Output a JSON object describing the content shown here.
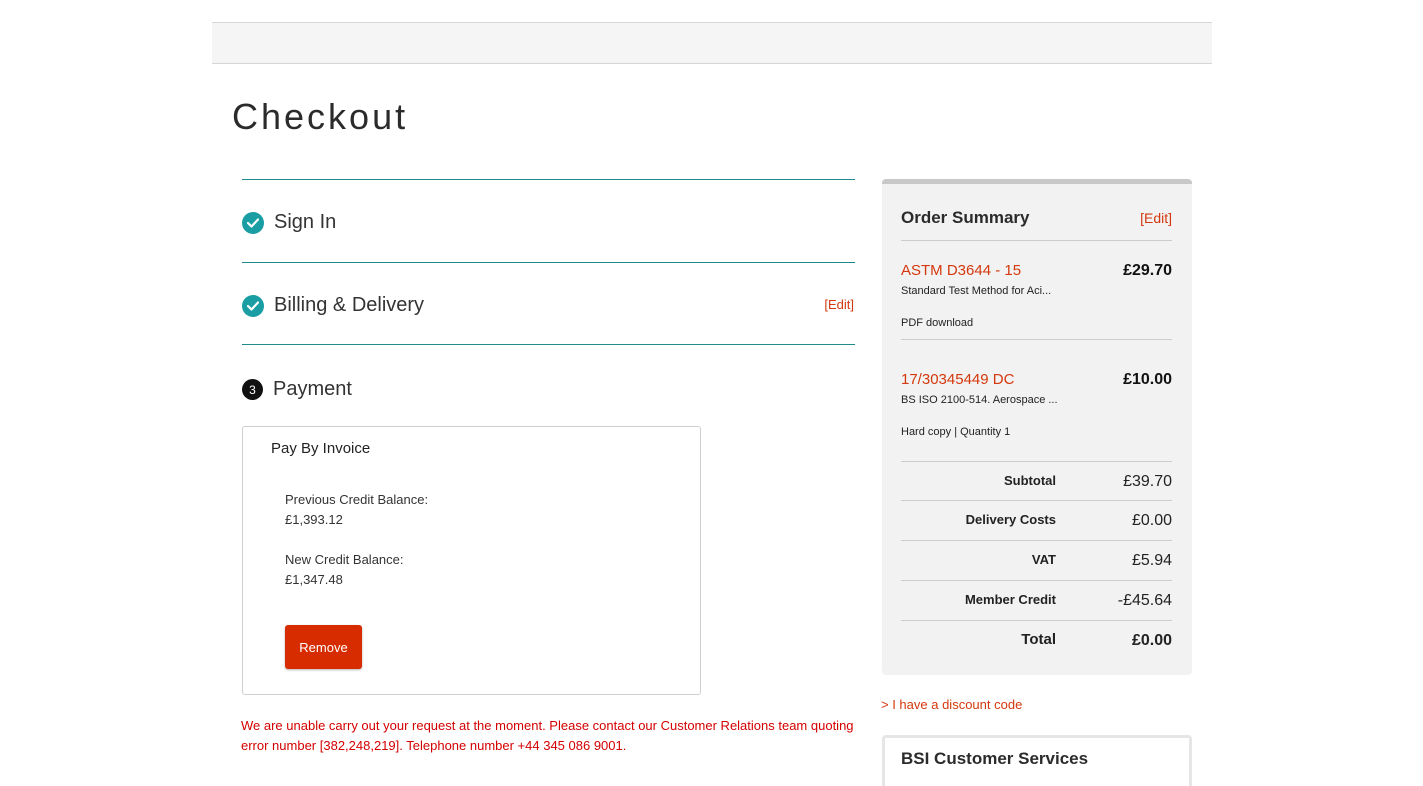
{
  "page": {
    "title": "Checkout"
  },
  "steps": {
    "sign_in": {
      "label": "Sign In"
    },
    "billing": {
      "label": "Billing & Delivery",
      "edit_label": "[Edit]"
    },
    "payment": {
      "label": "Payment",
      "number": "3"
    }
  },
  "payment_box": {
    "title": "Pay By Invoice",
    "previous_label": "Previous Credit Balance:",
    "previous_value": "£1,393.12",
    "new_label": "New Credit Balance:",
    "new_value": "£1,347.48",
    "remove_label": "Remove"
  },
  "error_message": "We are unable carry out your request at the moment. Please contact our Customer Relations team quoting error number [382,248,219]. Telephone number +44 345 086 9001.",
  "order_summary": {
    "title": "Order Summary",
    "edit_label": "[Edit]",
    "items": [
      {
        "code": "ASTM D3644 - 15",
        "price": "£29.70",
        "description": "Standard Test Method for Aci...",
        "meta": "PDF download"
      },
      {
        "code": "17/30345449 DC",
        "price": "£10.00",
        "description": "BS ISO 2100-514. Aerospace ...",
        "meta": "Hard copy | Quantity 1"
      }
    ],
    "totals": [
      {
        "label": "Subtotal",
        "value": "£39.70"
      },
      {
        "label": "Delivery Costs",
        "value": "£0.00"
      },
      {
        "label": "VAT",
        "value": "£5.94"
      },
      {
        "label": "Member Credit",
        "value": "-£45.64"
      },
      {
        "label": "Total",
        "value": "£0.00"
      }
    ]
  },
  "discount_link": "> I have a discount code",
  "customer_services": {
    "title": "BSI Customer Services"
  },
  "colors": {
    "accent_teal": "#1a9ea3",
    "link_red": "#d4380d",
    "button_red": "#d62c00",
    "error_red": "#d40000"
  }
}
